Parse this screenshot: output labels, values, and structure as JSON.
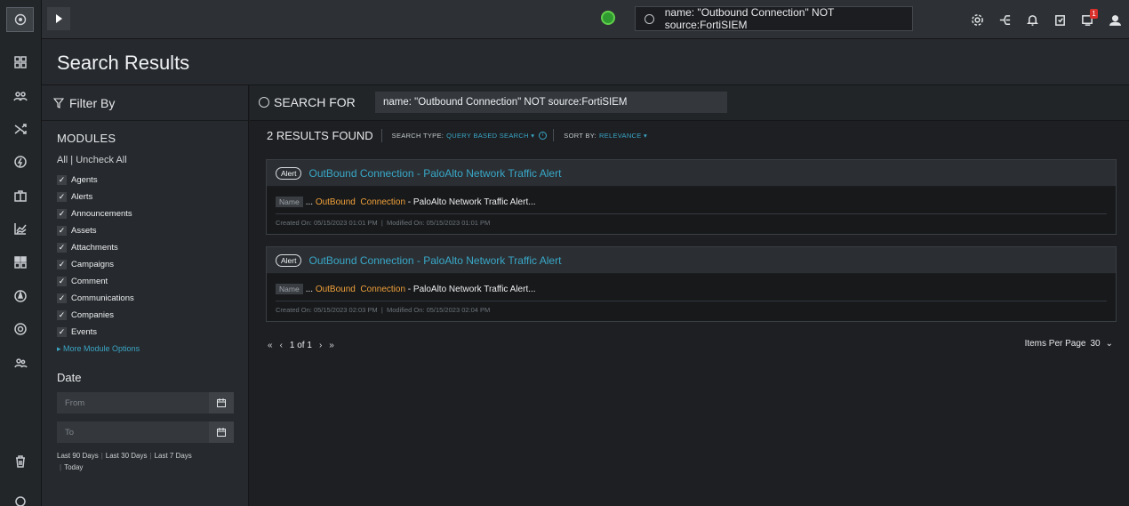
{
  "topbar": {
    "search_text": "name: \"Outbound Connection\" NOT source:FortiSIEM",
    "notification_badge": "1",
    "icons": [
      "gear-icon",
      "network-icon",
      "bell-icon",
      "clipboard-check-icon",
      "tasks-icon",
      "user-icon"
    ]
  },
  "header": {
    "title": "Search Results"
  },
  "filter": {
    "heading": "Filter By",
    "modules_title": "MODULES",
    "all_link": "All",
    "uncheck_link": "Uncheck All",
    "modules": [
      "Agents",
      "Alerts",
      "Announcements",
      "Assets",
      "Attachments",
      "Campaigns",
      "Comment",
      "Communications",
      "Companies",
      "Events"
    ],
    "more_options": "More Module Options",
    "date_title": "Date",
    "from_placeholder": "From",
    "to_placeholder": "To",
    "quick_dates": [
      "Last 90 Days",
      "Last 30 Days",
      "Last 7 Days",
      "Today"
    ]
  },
  "search": {
    "label": "SEARCH FOR",
    "query": "name: \"Outbound Connection\" NOT source:FortiSIEM",
    "results_count": "2 RESULTS FOUND",
    "search_type_label": "SEARCH TYPE:",
    "search_type_value": "QUERY BASED SEARCH",
    "sort_label": "SORT BY:",
    "sort_value": "RELEVANCE"
  },
  "results": [
    {
      "type": "Alert",
      "title": "OutBound Connection - PaloAlto Network Traffic Alert",
      "name_tag": "Name",
      "snippet_prefix": "...",
      "hl1": "OutBound",
      "hl2": "Connection",
      "snippet_suffix": "- PaloAlto Network Traffic Alert...",
      "created_on": "Created On:  05/15/2023 01:01 PM",
      "modified_on": "Modified On:  05/15/2023 01:01 PM"
    },
    {
      "type": "Alert",
      "title": "OutBound Connection - PaloAlto Network Traffic Alert",
      "name_tag": "Name",
      "snippet_prefix": "...",
      "hl1": "OutBound",
      "hl2": "Connection",
      "snippet_suffix": "- PaloAlto Network Traffic Alert...",
      "created_on": "Created On:  05/15/2023 02:03 PM",
      "modified_on": "Modified On:  05/15/2023 02:04 PM"
    }
  ],
  "pagination": {
    "first": "«",
    "prev": "‹",
    "page_text": "1 of 1",
    "next": "›",
    "last": "»",
    "per_page_label": "Items Per Page",
    "per_page_value": "30"
  },
  "colors": {
    "accent": "#39a7c8",
    "highlight": "#f0a03a",
    "status_green": "#61d04c",
    "badge_red": "#d9302b"
  }
}
